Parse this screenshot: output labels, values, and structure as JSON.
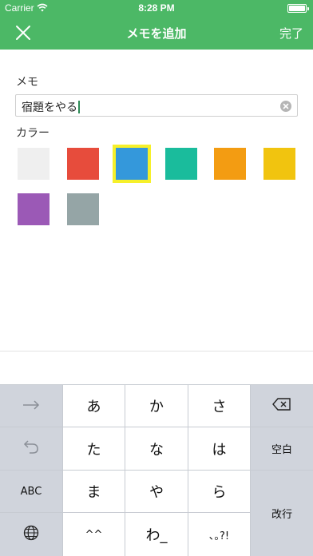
{
  "status": {
    "carrier": "Carrier",
    "time": "8:28 PM"
  },
  "nav": {
    "title": "メモを追加",
    "done": "完了"
  },
  "form": {
    "memo_label": "メモ",
    "memo_value": "宿題をやる",
    "color_label": "カラー"
  },
  "colors": [
    "#efefef",
    "#e74c3c",
    "#3498db",
    "#1abc9c",
    "#f39c12",
    "#f1c40f",
    "#9b59b6",
    "#95a5a6"
  ],
  "selected_color_index": 2,
  "keyboard": {
    "keys": {
      "a": "あ",
      "ka": "か",
      "sa": "さ",
      "ta": "た",
      "na": "な",
      "ha": "は",
      "ma": "ま",
      "ya": "や",
      "ra": "ら",
      "dakuten": "^^",
      "wa": "わ_",
      "punct": "､｡?!",
      "space": "空白",
      "abc": "ABC",
      "enter": "改行"
    }
  }
}
